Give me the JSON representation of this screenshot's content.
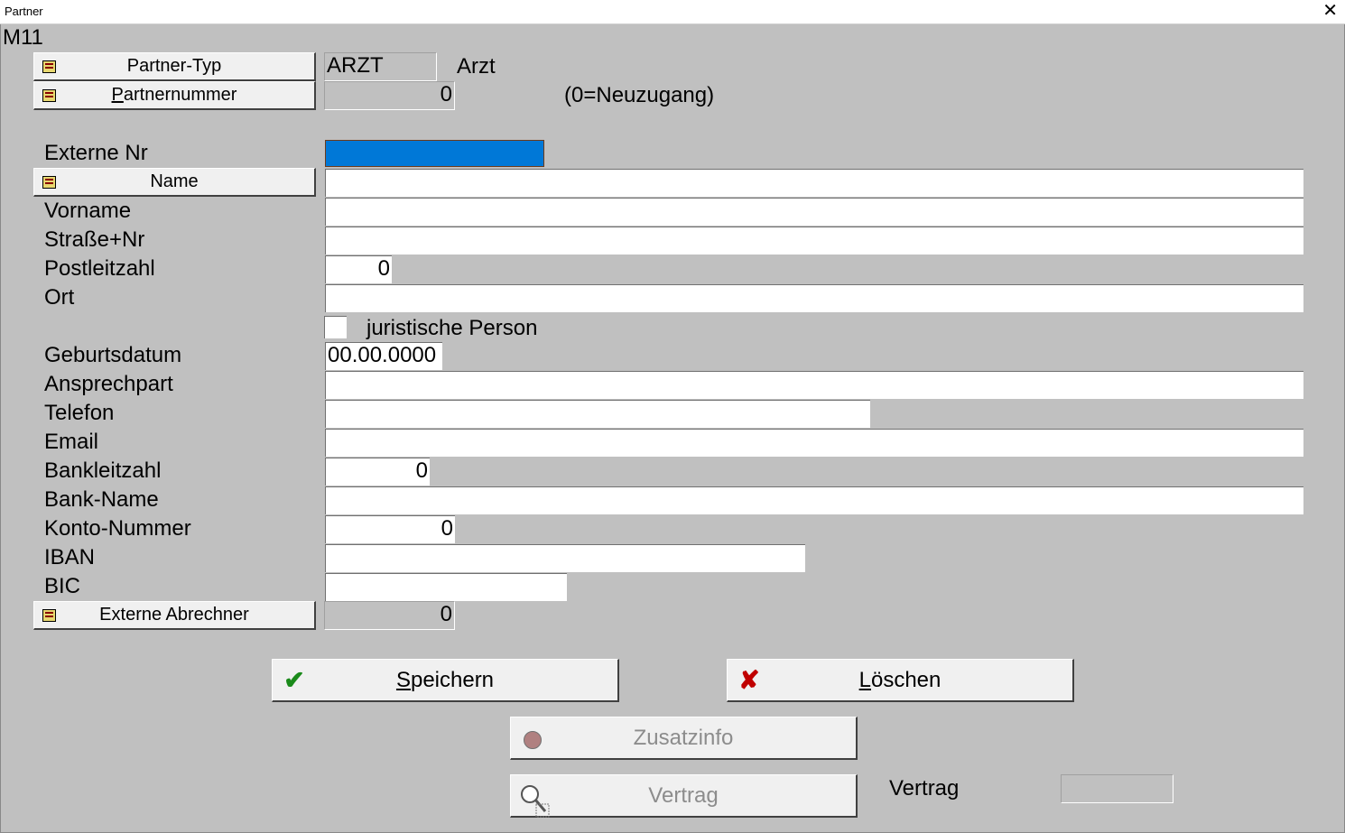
{
  "window": {
    "title": "Partner",
    "close_glyph": "✕"
  },
  "form_code": "M11",
  "partner_typ": {
    "button_label": "Partner-Typ",
    "value": "ARZT",
    "description": "Arzt"
  },
  "partnernummer": {
    "button_label_underlined": "P",
    "button_label_rest": "artnernummer",
    "value": "0",
    "hint": "(0=Neuzugang)"
  },
  "fields": {
    "externe_nr": {
      "label": "Externe Nr",
      "value": ""
    },
    "name": {
      "button_label": "Name",
      "value": ""
    },
    "vorname": {
      "label": "Vorname",
      "value": ""
    },
    "strasse": {
      "label": "Straße+Nr",
      "value": ""
    },
    "plz": {
      "label": "Postleitzahl",
      "value": "0"
    },
    "ort": {
      "label": "Ort",
      "value": ""
    },
    "juristische_person": {
      "label": "juristische Person",
      "checked": false
    },
    "geburtsdatum": {
      "label": "Geburtsdatum",
      "value": "00.00.0000"
    },
    "ansprechpart": {
      "label": "Ansprechpart",
      "value": ""
    },
    "telefon": {
      "label": "Telefon",
      "value": ""
    },
    "email": {
      "label": "Email",
      "value": ""
    },
    "bankleitzahl": {
      "label": "Bankleitzahl",
      "value": "0"
    },
    "bank_name": {
      "label": "Bank-Name",
      "value": ""
    },
    "konto_nummer": {
      "label": "Konto-Nummer",
      "value": "0"
    },
    "iban": {
      "label": "IBAN",
      "value": ""
    },
    "bic": {
      "label": "BIC",
      "value": ""
    },
    "externe_abrechner": {
      "button_label": "Externe Abrechner",
      "value": "0"
    }
  },
  "actions": {
    "speichern": {
      "label_underlined": "S",
      "label_rest": "peichern",
      "icon": "checkmark-icon"
    },
    "loeschen": {
      "label_underlined": "L",
      "label_rest": "öschen",
      "icon": "x-icon"
    },
    "zusatzinfo": {
      "label": "Zusatzinfo",
      "icon": "info-icon",
      "enabled": false
    },
    "vertrag": {
      "label": "Vertrag",
      "icon": "search-icon",
      "enabled": false
    }
  },
  "vertrag_status": {
    "label": "Vertrag",
    "value": ""
  },
  "colors": {
    "background": "#c0c0c0",
    "selection": "#0078d7",
    "check_green": "#1a8a1a",
    "delete_red": "#c00000"
  }
}
